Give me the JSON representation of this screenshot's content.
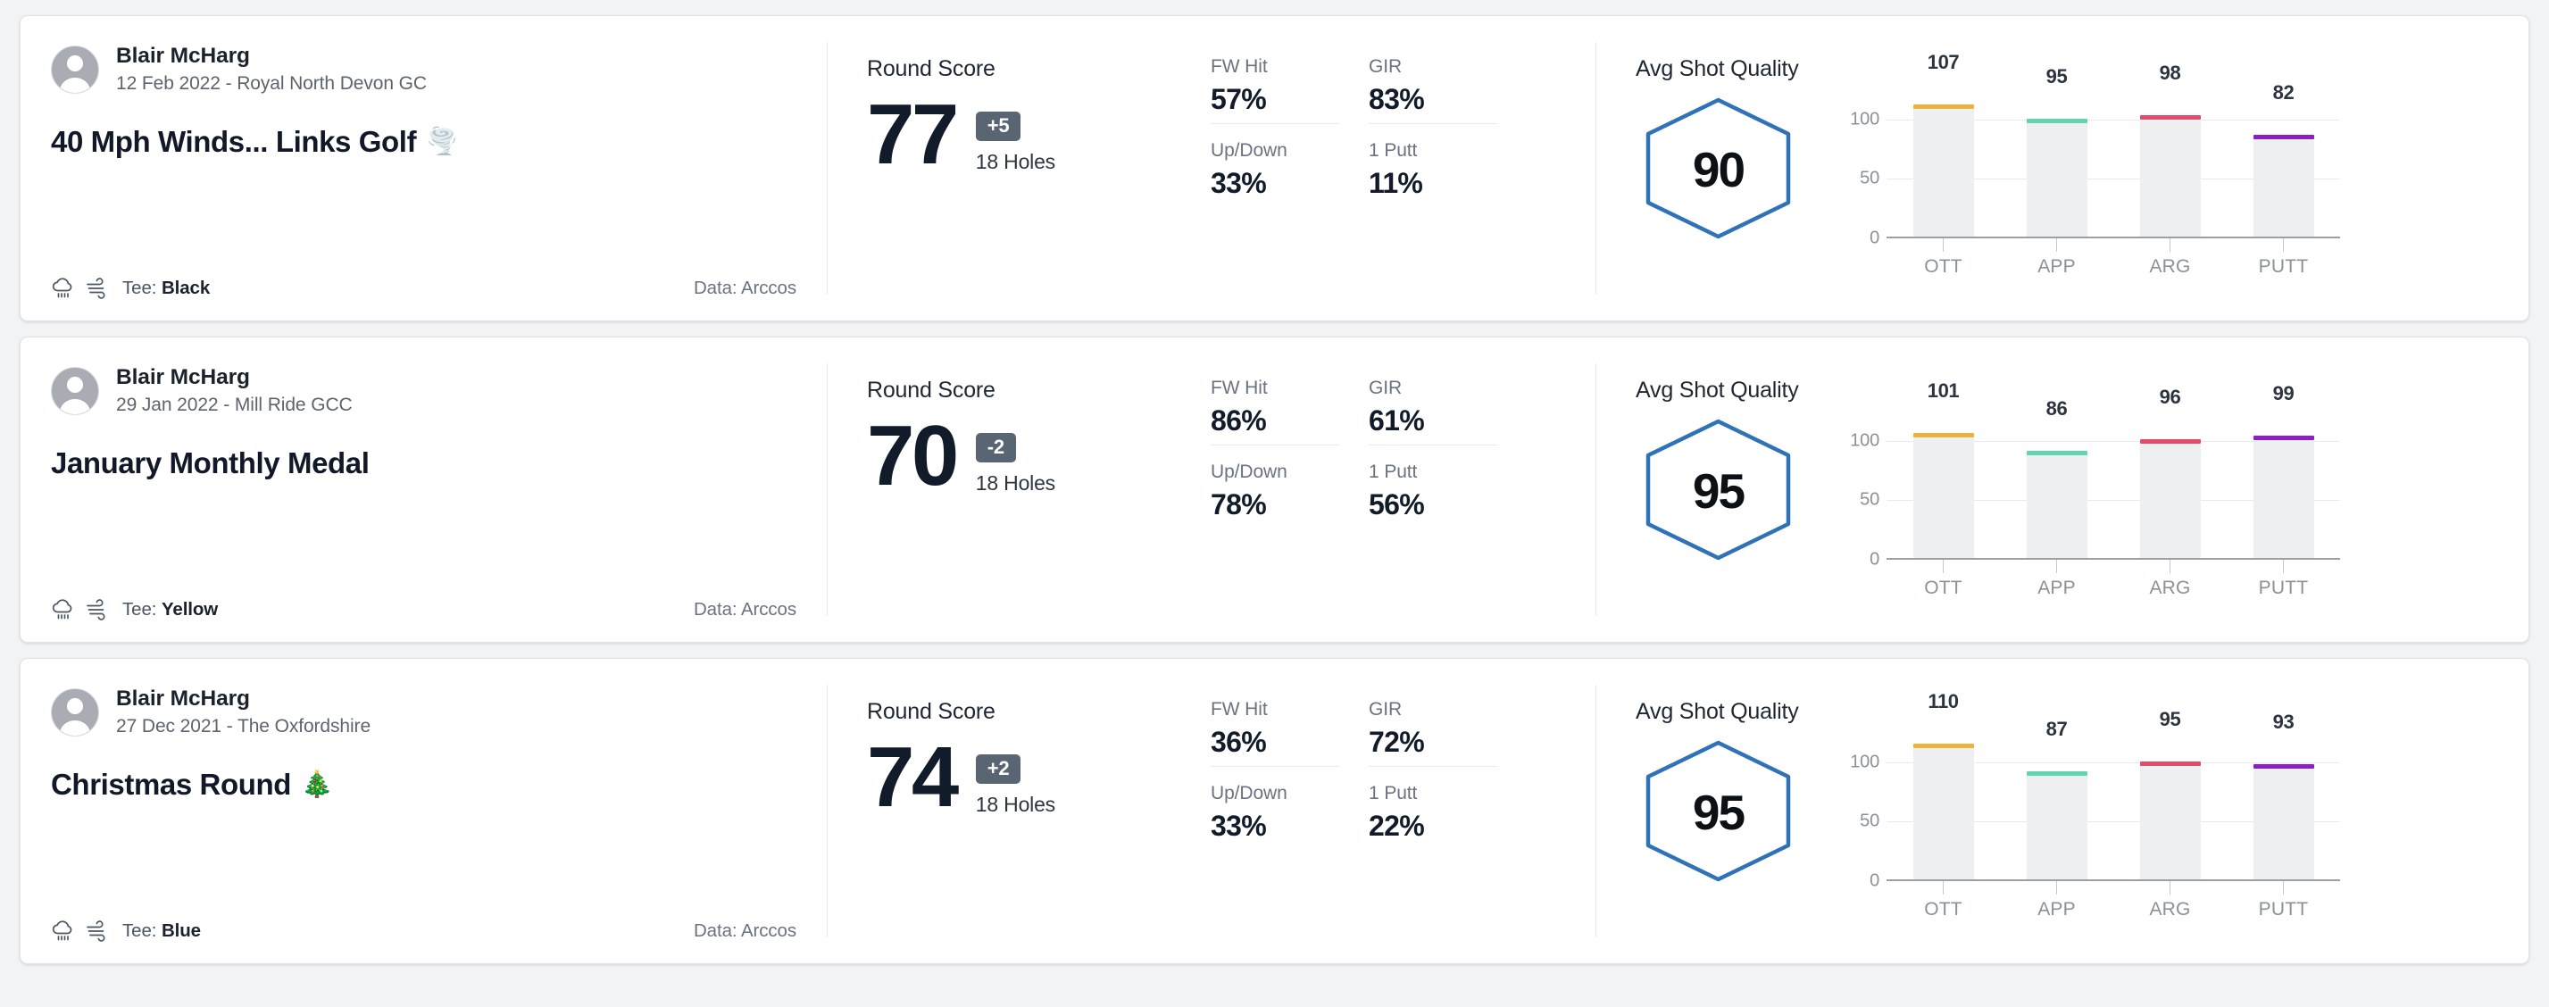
{
  "labels": {
    "round_score": "Round Score",
    "holes": "18 Holes",
    "avg_shot_quality": "Avg Shot Quality",
    "tee_prefix": "Tee: ",
    "data_prefix": "Data: "
  },
  "stat_names": {
    "fw_hit": "FW Hit",
    "gir": "GIR",
    "up_down": "Up/Down",
    "one_putt": "1 Putt"
  },
  "chart_axis": {
    "y_ticks": [
      "100",
      "50",
      "0"
    ],
    "categories": [
      "OTT",
      "APP",
      "ARG",
      "PUTT"
    ]
  },
  "colors": {
    "ott": "#efb13a",
    "app": "#5fd6af",
    "arg": "#e34b6c",
    "putt": "#8c1fc4",
    "hexagon_stroke": "#2f72b8",
    "diff_badge": "#5a6573",
    "card_border": "#e2e4e8",
    "page_background": "#f2f3f5"
  },
  "rounds": [
    {
      "player": "Blair McHarg",
      "date_course": "12 Feb 2022 - Royal North Devon GC",
      "title": "40 Mph Winds... Links Golf",
      "title_emoji": "🌪️",
      "tee": "Black",
      "data_source": "Arccos",
      "score": "77",
      "diff": "+5",
      "holes": "18 Holes",
      "stats": {
        "fw_hit": "57%",
        "gir": "83%",
        "up_down": "33%",
        "one_putt": "11%"
      },
      "avg_shot_quality": "90",
      "chart_data": {
        "type": "bar",
        "title": "Avg Shot Quality",
        "categories": [
          "OTT",
          "APP",
          "ARG",
          "PUTT"
        ],
        "values": [
          107,
          95,
          98,
          82
        ],
        "colors": [
          "#efb13a",
          "#5fd6af",
          "#e34b6c",
          "#8c1fc4"
        ],
        "ylim": [
          0,
          120
        ],
        "yticks": [
          0,
          50,
          100
        ],
        "ylabel": "",
        "xlabel": "",
        "grid": true,
        "legend": "none",
        "data_labels": [
          "107",
          "95",
          "98",
          "82"
        ]
      }
    },
    {
      "player": "Blair McHarg",
      "date_course": "29 Jan 2022 - Mill Ride GCC",
      "title": "January Monthly Medal",
      "title_emoji": "",
      "tee": "Yellow",
      "data_source": "Arccos",
      "score": "70",
      "diff": "-2",
      "holes": "18 Holes",
      "stats": {
        "fw_hit": "86%",
        "gir": "61%",
        "up_down": "78%",
        "one_putt": "56%"
      },
      "avg_shot_quality": "95",
      "chart_data": {
        "type": "bar",
        "title": "Avg Shot Quality",
        "categories": [
          "OTT",
          "APP",
          "ARG",
          "PUTT"
        ],
        "values": [
          101,
          86,
          96,
          99
        ],
        "colors": [
          "#efb13a",
          "#5fd6af",
          "#e34b6c",
          "#8c1fc4"
        ],
        "ylim": [
          0,
          120
        ],
        "yticks": [
          0,
          50,
          100
        ],
        "ylabel": "",
        "xlabel": "",
        "grid": true,
        "legend": "none",
        "data_labels": [
          "101",
          "86",
          "96",
          "99"
        ]
      }
    },
    {
      "player": "Blair McHarg",
      "date_course": "27 Dec 2021 - The Oxfordshire",
      "title": "Christmas Round",
      "title_emoji": "🎄",
      "tee": "Blue",
      "data_source": "Arccos",
      "score": "74",
      "diff": "+2",
      "holes": "18 Holes",
      "stats": {
        "fw_hit": "36%",
        "gir": "72%",
        "up_down": "33%",
        "one_putt": "22%"
      },
      "avg_shot_quality": "95",
      "chart_data": {
        "type": "bar",
        "title": "Avg Shot Quality",
        "categories": [
          "OTT",
          "APP",
          "ARG",
          "PUTT"
        ],
        "values": [
          110,
          87,
          95,
          93
        ],
        "colors": [
          "#efb13a",
          "#5fd6af",
          "#e34b6c",
          "#8c1fc4"
        ],
        "ylim": [
          0,
          120
        ],
        "yticks": [
          0,
          50,
          100
        ],
        "ylabel": "",
        "xlabel": "",
        "grid": true,
        "legend": "none",
        "data_labels": [
          "110",
          "87",
          "95",
          "93"
        ]
      }
    }
  ]
}
